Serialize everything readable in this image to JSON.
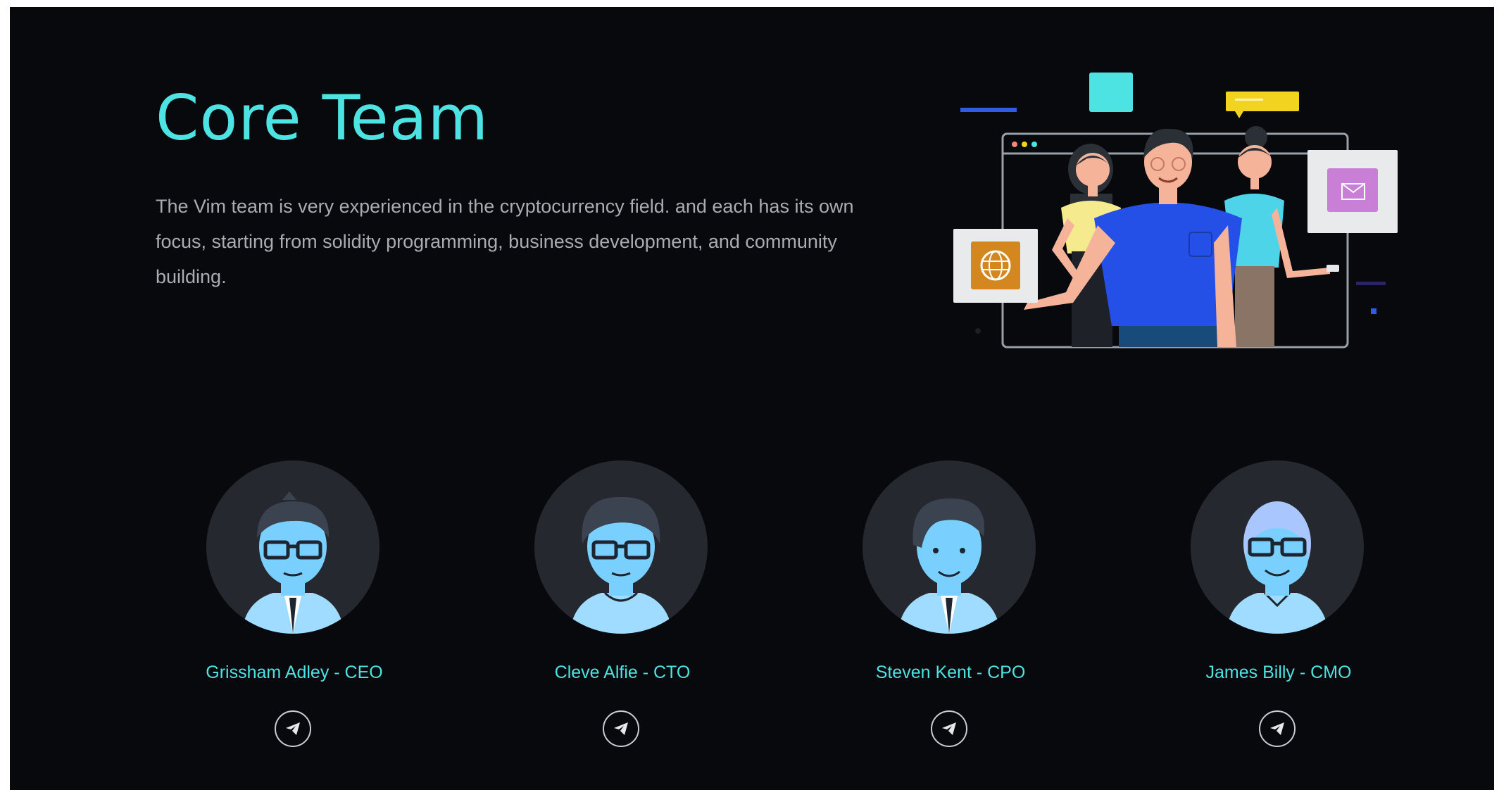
{
  "section": {
    "title": "Core Team",
    "description": "The Vim team is very experienced in the cryptocurrency field. and each has its own focus, starting from solidity programming, business development, and community building."
  },
  "colors": {
    "background": "#07090c",
    "accent": "#4de3e3",
    "text_muted": "#a9adb3",
    "avatar_bg": "#25282e",
    "face": "#7fd7ff"
  },
  "illustration": {
    "icons": [
      "globe-icon",
      "mail-icon",
      "chat-bubble-icon"
    ]
  },
  "team": [
    {
      "name": "Grissham Adley - CEO",
      "social_icon": "telegram-icon"
    },
    {
      "name": "Cleve Alfie - CTO",
      "social_icon": "telegram-icon"
    },
    {
      "name": "Steven Kent - CPO",
      "social_icon": "telegram-icon"
    },
    {
      "name": "James Billy - CMO",
      "social_icon": "telegram-icon"
    }
  ]
}
